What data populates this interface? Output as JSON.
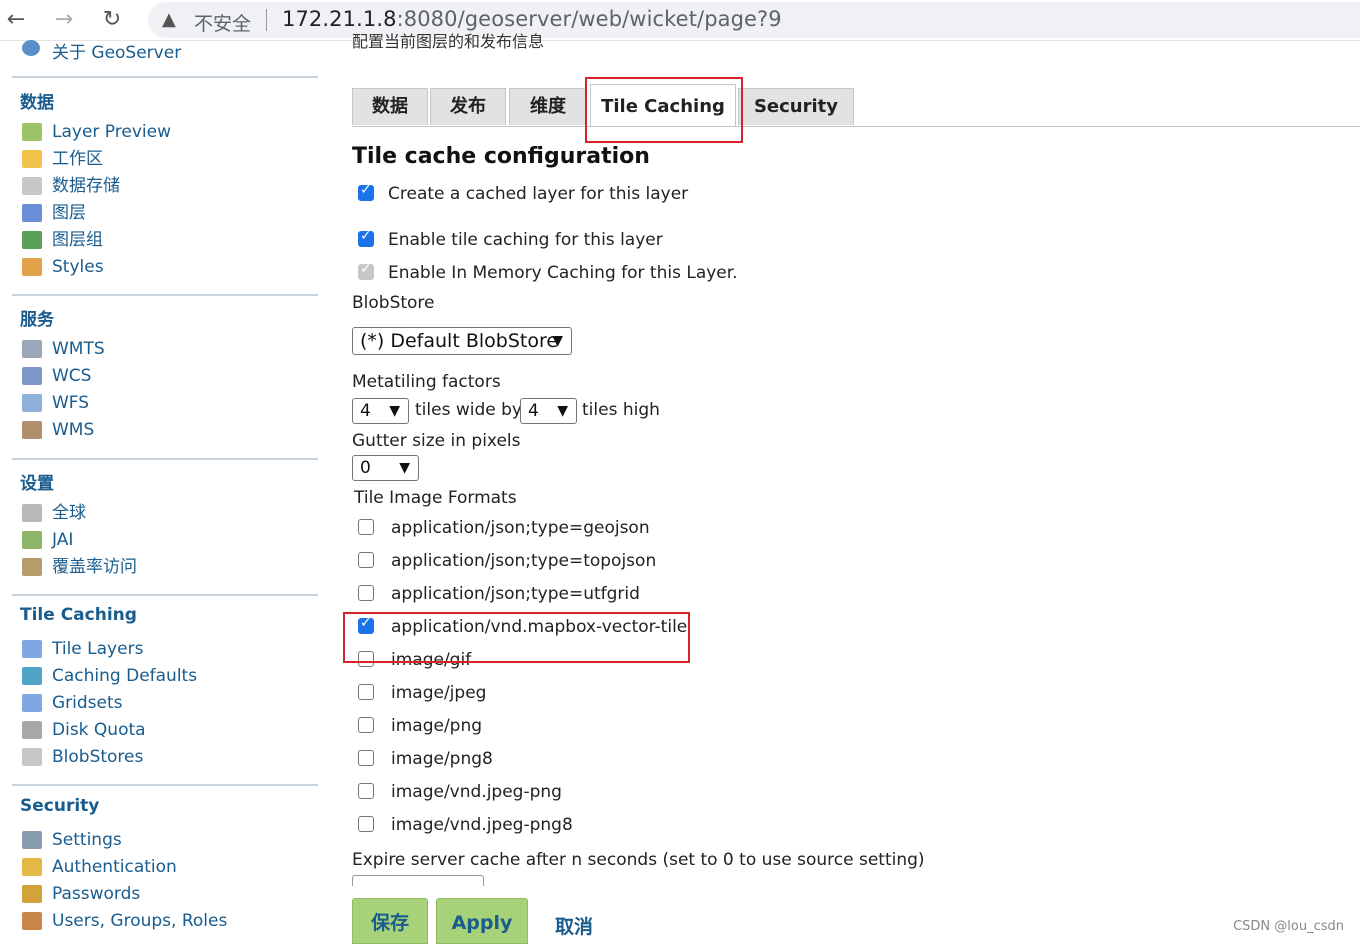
{
  "browser": {
    "back_icon": "←",
    "forward_icon": "→",
    "reload_icon": "↻",
    "warning_icon": "▲",
    "security_label": "不安全",
    "url_host": "172.21.1.8",
    "url_rest": ":8080/geoserver/web/wicket/page?9"
  },
  "sidebar": {
    "about": "关于 GeoServer",
    "sections": [
      {
        "title": "数据",
        "items": [
          "Layer Preview",
          "工作区",
          "数据存储",
          "图层",
          "图层组",
          "Styles"
        ]
      },
      {
        "title": "服务",
        "items": [
          "WMTS",
          "WCS",
          "WFS",
          "WMS"
        ]
      },
      {
        "title": "设置",
        "items": [
          "全球",
          "JAI",
          "覆盖率访问"
        ]
      },
      {
        "title": "Tile Caching",
        "items": [
          "Tile Layers",
          "Caching Defaults",
          "Gridsets",
          "Disk Quota",
          "BlobStores"
        ]
      },
      {
        "title": "Security",
        "items": [
          "Settings",
          "Authentication",
          "Passwords",
          "Users, Groups, Roles"
        ]
      }
    ]
  },
  "main": {
    "description": "配置当前图层的和发布信息",
    "tabs": [
      "数据",
      "发布",
      "维度",
      "Tile Caching",
      "Security"
    ],
    "active_tab": "Tile Caching",
    "heading": "Tile cache configuration",
    "create_cached_layer": {
      "label": "Create a cached layer for this layer",
      "checked": true
    },
    "enable_tile_caching": {
      "label": "Enable tile caching for this layer",
      "checked": true
    },
    "enable_in_memory": {
      "label": "Enable In Memory Caching for this Layer.",
      "checked": true,
      "disabled": true
    },
    "blobstore_label": "BlobStore",
    "blobstore_value": "(*) Default BlobStore",
    "metatiling_label": "Metatiling factors",
    "metatile_wide": "4",
    "tiles_wide_by": "tiles wide by",
    "metatile_high": "4",
    "tiles_high": "tiles high",
    "gutter_label": "Gutter size in pixels",
    "gutter_value": "0",
    "formats_label": "Tile Image Formats",
    "formats": [
      {
        "label": "application/json;type=geojson",
        "checked": false
      },
      {
        "label": "application/json;type=topojson",
        "checked": false
      },
      {
        "label": "application/json;type=utfgrid",
        "checked": false
      },
      {
        "label": "application/vnd.mapbox-vector-tile",
        "checked": true
      },
      {
        "label": "image/gif",
        "checked": false
      },
      {
        "label": "image/jpeg",
        "checked": false
      },
      {
        "label": "image/png",
        "checked": false
      },
      {
        "label": "image/png8",
        "checked": false
      },
      {
        "label": "image/vnd.jpeg-png",
        "checked": false
      },
      {
        "label": "image/vnd.jpeg-png8",
        "checked": false
      }
    ],
    "expire_label": "Expire server cache after n seconds (set to 0 to use source setting)",
    "save_label": "保存",
    "apply_label": "Apply",
    "cancel_label": "取消"
  },
  "watermark": "CSDN @lou_csdn",
  "colors": {
    "link": "#1a5c8e",
    "highlight": "#d6242b",
    "button": "#a7d27a",
    "checkbox": "#1a73e8"
  }
}
